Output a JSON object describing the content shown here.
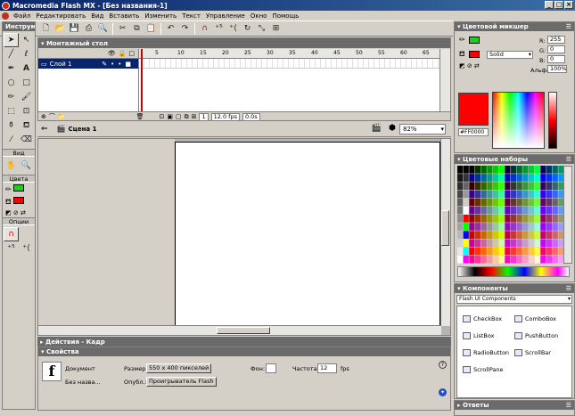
{
  "window": {
    "title": "Macromedia Flash MX - [Без названия-1]"
  },
  "menu": [
    "Файл",
    "Редактировать",
    "Вид",
    "Вставить",
    "Изменить",
    "Текст",
    "Управление",
    "Окно",
    "Помощь"
  ],
  "tools_panel": {
    "title": "Инструменты",
    "view_label": "Вид",
    "colors_label": "Цвета",
    "options_label": "Опции"
  },
  "timeline": {
    "title": "Монтажный стол",
    "layer_name": "Слой 1",
    "ruler": [
      "5",
      "10",
      "15",
      "20",
      "25",
      "30",
      "35",
      "40",
      "45",
      "50",
      "55",
      "60",
      "65"
    ],
    "frame": "1",
    "fps": "12.0 fps",
    "time": "0.0s"
  },
  "scene": {
    "name": "Сцена 1",
    "zoom": "82%"
  },
  "actions_panel": {
    "title": "Действия - Кадр"
  },
  "properties": {
    "title": "Свойства",
    "doc_label": "Документ",
    "doc_name": "Без назва...",
    "size_label": "Размер:",
    "size_value": "550 x 400 пикселей",
    "publish_label": "Опубл.:",
    "publish_value": "Проигрыватель Flash",
    "bg_label": "Фон:",
    "fps_label": "Частота:",
    "fps_value": "12",
    "fps_unit": "fps"
  },
  "color_mixer": {
    "title": "Цветовой микшер",
    "fill_type": "Solid",
    "r_label": "R:",
    "r_value": "255",
    "g_label": "G:",
    "g_value": "0",
    "b_label": "B:",
    "b_value": "0",
    "alpha_label": "Альфа:",
    "alpha_value": "100%",
    "hex": "#FF0000",
    "stroke_color": "#22cc22",
    "fill_color": "#ff0000"
  },
  "swatches_panel": {
    "title": "Цветовые наборы"
  },
  "components_panel": {
    "title": "Компоненты",
    "set": "Flash UI Components",
    "items": [
      "CheckBox",
      "ComboBox",
      "ListBox",
      "PushButton",
      "RadioButton",
      "ScrollBar",
      "ScrollPane"
    ]
  },
  "answers_panel": {
    "title": "Ответы"
  }
}
